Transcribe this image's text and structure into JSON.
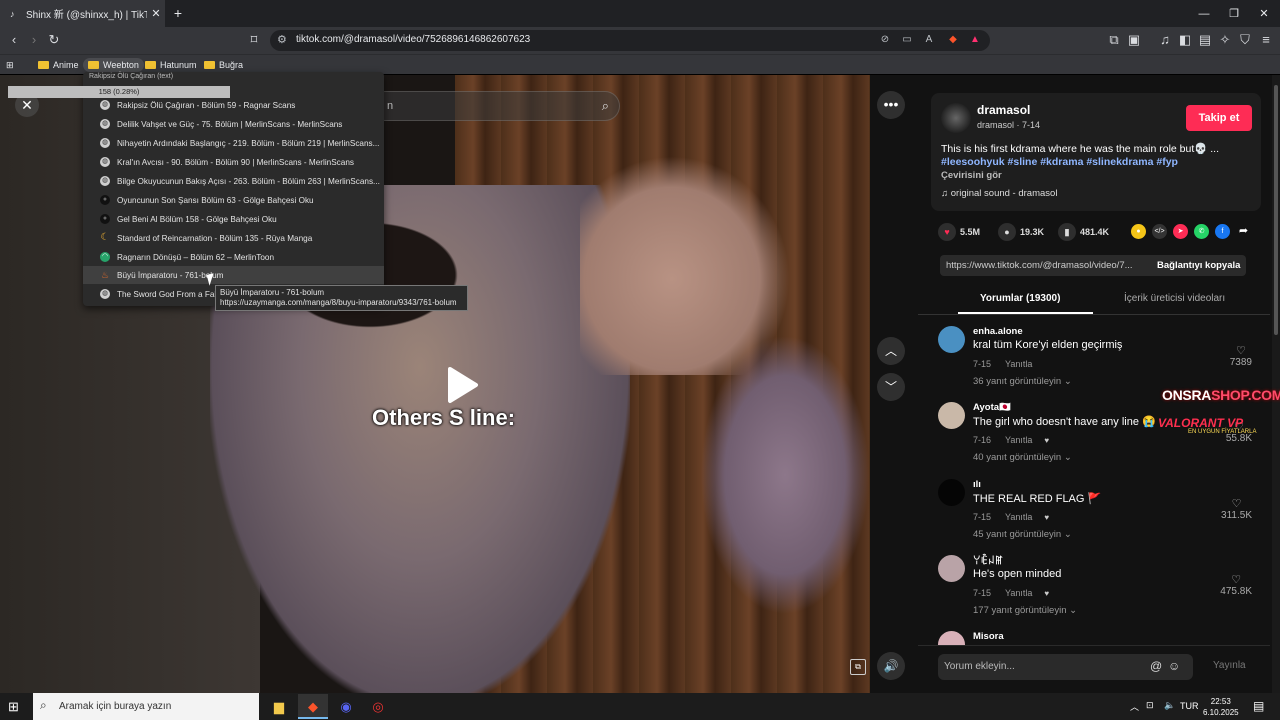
{
  "browser": {
    "tab_title": "Shinx 新 (@shinxx_h) | TikTok",
    "tab_favicon": "tiktok-icon",
    "url": "tiktok.com/@dramasol/video/7526896146862607623",
    "bookmarks": [
      "Anime",
      "Weebton",
      "Hatunum",
      "Buğra"
    ]
  },
  "video": {
    "caption": "Others S line:",
    "search_placeholder": "n"
  },
  "dropdown": {
    "header": "Rakipsiz Ölü Çağıran (text)",
    "progress": "158 (0.28%)",
    "items": [
      {
        "label": "Rakipsiz Ölü Çağıran - Bölüm 59 - Ragnar Scans",
        "icon": "globe-icon",
        "color": "#cfcfcf"
      },
      {
        "label": "Delilik Vahşet ve Güç - 75. Bölüm | MerlinScans - MerlinScans",
        "icon": "globe-icon",
        "color": "#cfcfcf"
      },
      {
        "label": "Nihayetin Ardındaki Başlangıç - 219. Bölüm - Bölüm 219 | MerlinScans...",
        "icon": "globe-icon",
        "color": "#cfcfcf"
      },
      {
        "label": "Kral'ın Avcısı - 90. Bölüm - Bölüm 90 | MerlinScans - MerlinScans",
        "icon": "globe-icon",
        "color": "#cfcfcf"
      },
      {
        "label": "Bilge Okuyucunun Bakış Açısı - 263. Bölüm - Bölüm 263 | MerlinScans...",
        "icon": "globe-icon",
        "color": "#cfcfcf"
      },
      {
        "label": "Oyuncunun Son Şansı Bölüm 63 - Gölge Bahçesi Oku",
        "icon": "shadow-icon",
        "color": "#111111"
      },
      {
        "label": "Gel Beni Al Bölüm 158 - Gölge Bahçesi Oku",
        "icon": "shadow-icon",
        "color": "#111111"
      },
      {
        "label": "Standard of Reincarnation - Bölüm 135 - Rüya Manga",
        "icon": "moon-icon",
        "color": "#f2b233"
      },
      {
        "label": "Ragnarın Dönüşü – Bölüm 62 – MerlinToon",
        "icon": "merlin-icon",
        "color": "#27a36a"
      },
      {
        "label": "Büyü İmparatoru - 761-bolum",
        "icon": "flame-icon",
        "color": "#e06a2a"
      },
      {
        "label": "The Sword God From a Fallen...",
        "icon": "globe-icon",
        "color": "#cfcfcf"
      }
    ],
    "tooltip_title": "Büyü İmparatoru - 761-bolum",
    "tooltip_url": "https://uzaymanga.com/manga/8/buyu-imparatoru/9343/761-bolum"
  },
  "post": {
    "username": "dramasol",
    "subline": "dramasol · 7-14",
    "follow_label": "Takip et",
    "description": "This is his first kdrama where he was the main role but💀 ...",
    "hashtags": "#leesoohyuk #sline #kdrama #slinekdrama #fyp",
    "translate_label": "Çevirisini gör",
    "sound": "original sound - dramasol",
    "likes": "5.5M",
    "comments": "19.3K",
    "saves": "481.4K",
    "link": "https://www.tiktok.com/@dramasol/video/7...",
    "copy_label": "Bağlantıyı kopyala",
    "tab_comments": "Yorumlar (19300)",
    "tab_creator": "İçerik üreticisi videoları"
  },
  "comments": [
    {
      "name": "enha.alone",
      "text": "kral tüm Kore'yi elden geçirmiş",
      "date": "7-15",
      "reply": "Yanıtla",
      "likes": "7389",
      "more": "36 yanıt görüntüleyin",
      "avatar": "#4a90c2"
    },
    {
      "name": "Ayota🇯🇵",
      "text": "The girl who doesn't have any line 😭",
      "date": "7-16",
      "reply": "Yanıtla",
      "likes": "55.8K",
      "more": "40 yanıt görüntüleyin",
      "avatar": "#c9b8a8"
    },
    {
      "name": "ılı",
      "text": "THE REAL RED FLAG 🚩",
      "date": "7-15",
      "reply": "Yanıtla",
      "likes": "311.5K",
      "more": "45 yanıt görüntüleyin",
      "avatar": "#050505"
    },
    {
      "name": "ꌩꍟꈤꂵ",
      "text": "He's open minded",
      "date": "7-15",
      "reply": "Yanıtla",
      "likes": "475.8K",
      "more": "177 yanıt görüntüleyin",
      "avatar": "#b9a3a7"
    },
    {
      "name": "Misora",
      "text": "",
      "date": "",
      "reply": "",
      "likes": "",
      "more": "",
      "avatar": "#d8b0b8"
    }
  ],
  "comment_bar": {
    "placeholder": "Yorum ekleyin...",
    "post_label": "Yayınla"
  },
  "overlay_ad": {
    "line1_a": "ONSRA",
    "line1_b": "SHOP.COM",
    "line2": "VALORANT VP",
    "line3": "EN UYGUN FİYATLARLA"
  },
  "taskbar": {
    "search_placeholder": "Aramak için buraya yazın",
    "language": "TUR",
    "time": "22:53",
    "date": "6.10.2025"
  }
}
